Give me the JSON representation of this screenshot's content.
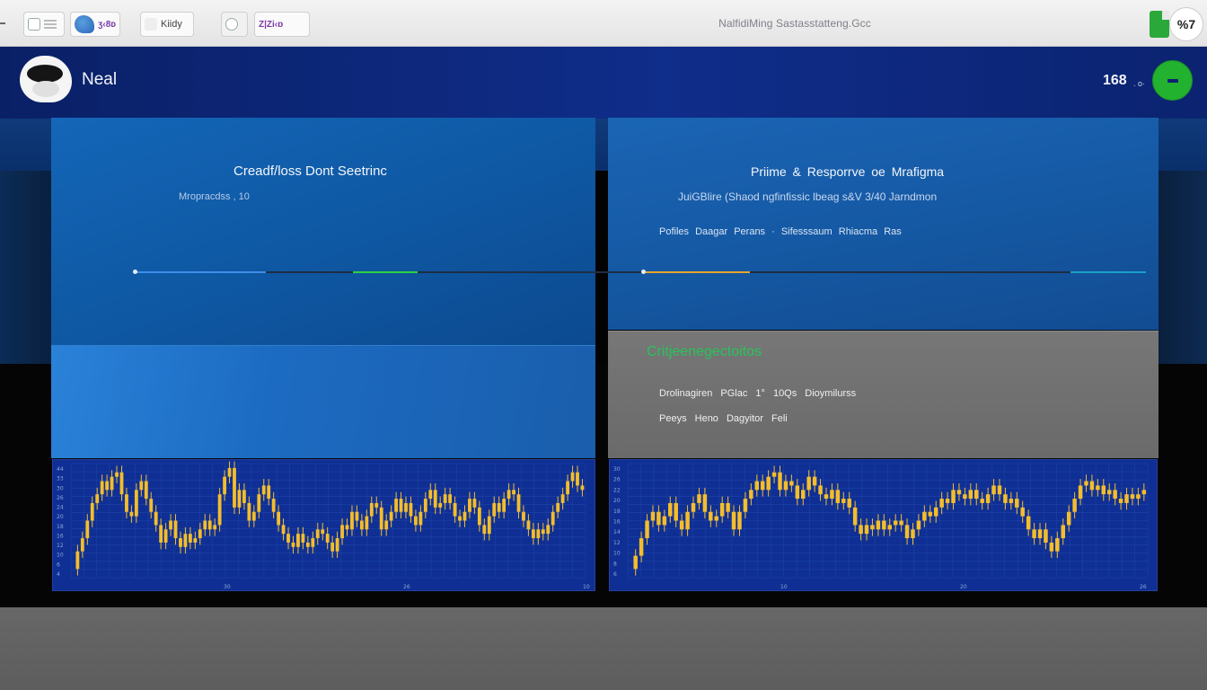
{
  "topbar": {
    "tab_purple": "ʒ‹8ᴅ",
    "tab_label": "Kiidy",
    "tab_purple2": "Z|Zi‹ɒ",
    "window_title": "NalfidiMing  Sastasstatteng.Gcc",
    "badge": "%7"
  },
  "header": {
    "user_name": "Neal",
    "count": "168",
    "count_suffix": ". o·"
  },
  "left_panel": {
    "title": "Creadf/loss Dont Seetrinc",
    "subtitle": "Mropracdss , 10"
  },
  "right_panel": {
    "title": "Priime &  Resporrve oe  Mrafigma",
    "subtitle": "JuiGBlire (Shaod ngfinfissic  lbeag  s&V 3/40  Jarndmon",
    "meta": "Pofiles  Daagar  Perans  ·  Sifesssaum  Rhiacma  Ras"
  },
  "critical": {
    "title": "Critjeenegectoitos",
    "line1": "Drolinagiren  PGlac  1° 10Qs  Dioymilurss",
    "line2": "Peeys  Heno  Dagyitor  Feli"
  },
  "colors": {
    "accent_green": "#23b130",
    "chart_bg": "#0f2f94",
    "candle": "#f4bd2b",
    "progress_blue": "#3f8ee8",
    "progress_green": "#2ad23f",
    "progress_orange": "#e7a42a",
    "progress_cyan": "#1aa0c8"
  },
  "progress": {
    "segments": [
      {
        "from": 0.0,
        "to": 0.13,
        "color": "#3f8ee8"
      },
      {
        "from": 0.216,
        "to": 0.28,
        "color": "#2ad23f"
      },
      {
        "from": 0.503,
        "to": 0.608,
        "color": "#e7a42a"
      },
      {
        "from": 0.925,
        "to": 1.0,
        "color": "#1aa0c8"
      }
    ]
  },
  "chart_data": [
    {
      "type": "candlestick",
      "x_ticks": [
        "30",
        "26",
        "10"
      ],
      "y_ticks": [
        "44",
        "33",
        "30",
        "26",
        "24",
        "20",
        "18",
        "16",
        "12",
        "10",
        "6",
        "4"
      ],
      "series": [
        {
          "values": [
            4,
            12,
            18,
            26,
            34,
            38,
            44,
            40,
            46,
            48,
            38,
            30,
            28,
            40,
            44,
            36,
            30,
            24,
            16,
            22,
            26,
            18,
            14,
            20,
            16,
            18,
            22,
            26,
            22,
            24,
            38,
            46,
            50,
            32,
            40,
            34,
            26,
            30,
            38,
            42,
            36,
            30,
            24,
            20,
            16,
            14,
            20,
            16,
            14,
            18,
            22,
            20,
            16,
            12,
            18,
            24,
            22,
            30,
            26,
            22,
            28,
            34,
            32,
            22,
            26,
            30,
            36,
            30,
            34,
            28,
            24,
            30,
            36,
            40,
            32,
            34,
            38,
            34,
            28,
            26,
            30,
            36,
            32,
            24,
            20,
            28,
            34,
            30,
            36,
            40,
            38,
            30,
            26,
            22,
            18,
            22,
            20,
            24,
            30,
            34,
            38,
            44,
            48,
            42,
            40
          ]
        }
      ]
    },
    {
      "type": "candlestick",
      "x_ticks": [
        "10",
        "20",
        "26"
      ],
      "y_ticks": [
        "30",
        "26",
        "22",
        "20",
        "18",
        "16",
        "14",
        "12",
        "10",
        "8",
        "6"
      ],
      "series": [
        {
          "values": [
            4,
            10,
            18,
            26,
            30,
            24,
            28,
            34,
            26,
            22,
            30,
            34,
            38,
            30,
            26,
            28,
            34,
            30,
            22,
            30,
            36,
            40,
            44,
            40,
            46,
            48,
            40,
            44,
            42,
            36,
            40,
            46,
            42,
            38,
            36,
            40,
            34,
            36,
            32,
            24,
            20,
            24,
            22,
            26,
            22,
            24,
            26,
            24,
            18,
            22,
            26,
            30,
            28,
            32,
            36,
            34,
            40,
            38,
            36,
            40,
            36,
            34,
            38,
            42,
            38,
            34,
            36,
            32,
            28,
            22,
            18,
            22,
            16,
            12,
            18,
            24,
            30,
            36,
            42,
            44,
            40,
            42,
            38,
            40,
            36,
            34,
            38,
            36,
            38,
            40
          ]
        }
      ]
    }
  ]
}
